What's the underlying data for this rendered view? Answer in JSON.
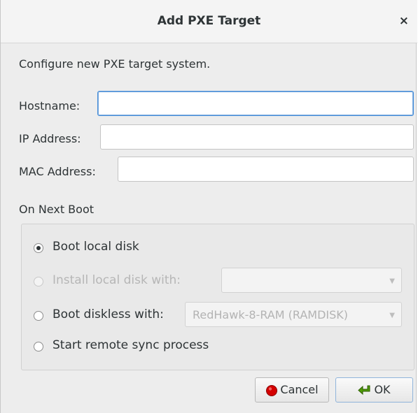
{
  "dialog": {
    "title": "Add PXE Target",
    "close_glyph": "×",
    "description": "Configure new PXE target system."
  },
  "fields": {
    "hostname_label": "Hostname:",
    "hostname_value": "",
    "ip_label": "IP Address:",
    "ip_value": "",
    "mac_label": "MAC Address:",
    "mac_value": ""
  },
  "boot": {
    "section_label": "On Next Boot",
    "options": [
      {
        "label": "Boot local disk",
        "checked": true,
        "disabled": false
      },
      {
        "label": "Install local disk with:",
        "checked": false,
        "disabled": true
      },
      {
        "label": "Boot diskless with:",
        "checked": false,
        "disabled": false
      },
      {
        "label": "Start remote sync process",
        "checked": false,
        "disabled": false
      }
    ],
    "install_combo_value": "",
    "diskless_combo_value": "RedHawk-8-RAM (RAMDISK)"
  },
  "buttons": {
    "cancel_label": "Cancel",
    "cancel_icon": "red-circle-icon",
    "ok_label": "OK",
    "ok_icon": "green-arrow-icon"
  },
  "colors": {
    "accent_focus": "#4a90d9",
    "cancel_icon": "#d40000",
    "ok_icon": "#4e9a06"
  }
}
